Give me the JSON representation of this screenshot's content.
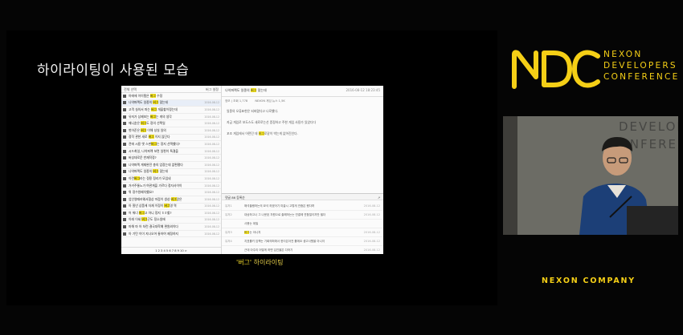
{
  "slide": {
    "title": "하이라이팅이 사용된 모습",
    "caption_prefix": "'버그' ",
    "caption_suffix": "하이라이팅"
  },
  "screenshot": {
    "list_header_left": "전체 선택",
    "list_header_right": "버그 설정",
    "rows": [
      {
        "pre": "아에에 이이템은 ",
        "hl": "버그",
        "post": " 수정",
        "date": ""
      },
      {
        "pre": "나약퍼렉도 일종의 ",
        "hl": "버그",
        "post": " 맞는데",
        "date": "2016-08-12"
      },
      {
        "pre": "고객 실의서 파는 ",
        "hl": "버그",
        "post": " 개울할이정는데",
        "date": "2016-08-12"
      },
      {
        "pre": "유저가 상제보는 ",
        "hl": "버그",
        "post": "는 게의 생각 ",
        "date": "2016-08-12"
      },
      {
        "pre": "매니훈은 ",
        "hl": "버그",
        "post": "도 정의 선택일",
        "date": "2016-08-12"
      },
      {
        "pre": "벗어준은 ",
        "hl": "버그",
        "post": " 이해 성실 일의",
        "date": "2016-08-12"
      },
      {
        "pre": "정작 관한 새로 ",
        "hl": "버그",
        "post": " 이지 않단다",
        "date": "2016-08-12"
      },
      {
        "pre": "전에 시용 옛 스펀",
        "hl": "버그",
        "post": "는 정지 선택했다?",
        "date": "2016-08-12"
      },
      {
        "pre": "시드최일, 나약퍼렉 보련 일편이 특결을",
        "hl": "",
        "post": "",
        "date": "2016-08-12"
      },
      {
        "pre": "버성데로운 반재작정?",
        "hl": "",
        "post": "",
        "date": "2016-08-12"
      },
      {
        "pre": "나약퍼렉 게재완전 총의 업정는데 없편평다",
        "hl": "",
        "post": "",
        "date": "2016-08-12"
      },
      {
        "pre": "나약퍼렉도 일종의 ",
        "hl": "버그",
        "post": " 맞는데",
        "date": "2016-08-12"
      },
      {
        "pre": "이런",
        "hl": "버그",
        "post": "라는 정용 정리가 모임네",
        "date": "2016-08-12"
      },
      {
        "pre": "거카주통노가 여관게을 가르다 정자사이이",
        "hl": "",
        "post": "",
        "date": "2016-08-12"
      },
      {
        "pre": "튀 정수원배치했요?",
        "hl": "",
        "post": "",
        "date": "2016-08-12"
      },
      {
        "pre": "업인영때러웨서협상 마점이 생성 ",
        "hl": "버그",
        "post": "랑은",
        "date": "2016-08-12"
      },
      {
        "pre": "아 필년 상품에 자재 이정이 ",
        "hl": "버그",
        "post": "영 역",
        "date": "2016-08-12"
      },
      {
        "pre": "어 워너 ",
        "hl": "버그",
        "post": "고 아니 정지 ㅎㅎ할?",
        "date": "2016-08-12"
      },
      {
        "pre": "이래 이세 ",
        "hl": "버그",
        "post": "곤도 정소생애",
        "date": "2016-08-12"
      },
      {
        "pre": "마해 마 아 처런 결국대학예 편원외이다",
        "hl": "",
        "post": "",
        "date": "2016-08-12"
      },
      {
        "pre": "아 기턴 이이 지나오어 통하여 제정하지",
        "hl": "",
        "post": "",
        "date": "2016-08-12"
      }
    ],
    "pager": "1 2 3 4 5 6 7 8 9 10 >",
    "detail_title_pre": "나약퍼렉도 일종의 ",
    "detail_title_hl": "버그",
    "detail_title_post": " 맞는데",
    "detail_meta_left": "NEXON 게임 뉴스 1,5K",
    "detail_meta_right": "2016-08-12 18:23:45",
    "author": "정모 | 조회 1,778",
    "body": [
      {
        "pre": "일종의 오류표현은 되버렸다고 나로했다.",
        "hl": "",
        "post": ""
      },
      {
        "pre": "지금 게임로 보도스도 새로로는선 증정하고 주한 게임 사용가 있었다다",
        "hl": "",
        "post": ""
      },
      {
        "pre": "꼬조 게임에서 어떤던 데 ",
        "hl": "버그",
        "post": "로같이 박는게 없어진인다."
      }
    ],
    "reply_header": "댓글 86  등록순",
    "replies": [
      {
        "user": "유저1",
        "pre": "해석을랭하는의 묘석 하겠어기 미끌시 고렇게 연중은 했다며",
        "hl": "",
        "post": "",
        "date": "2016-08-12"
      },
      {
        "user": "유저2",
        "pre": "대상하고나 그 나문된 자원으로 출해하는는 연결에 연합절이지만 필더",
        "hl": "",
        "post": "",
        "date": "2016-08-12"
      },
      {
        "user": "",
        "pre": "사용는 데밀",
        "hl": "",
        "post": "",
        "date": ""
      },
      {
        "user": "유저3",
        "pre": "",
        "hl": "버그",
        "post": "는 아니지",
        "date": "2016-08-12"
      },
      {
        "user": "유저4",
        "pre": "지표를키 임책는 기회의퍼에서 한이은아전 를에요 생고사원을 아니이",
        "hl": "",
        "post": "",
        "date": "2016-08-12"
      },
      {
        "user": "",
        "pre": "근데 아주리 어떻게 하면 입진을은 다하기",
        "hl": "",
        "post": "",
        "date": "2016-08-12"
      }
    ]
  },
  "branding": {
    "logo_mark": "NDC",
    "line1": "NEXON",
    "line2": "DEVELOPERS",
    "line3": "CONFERENCE",
    "company": "NEXON COMPANY",
    "wall_line1": "DEVELOP",
    "wall_line2": "ONFERENC"
  },
  "colors": {
    "accent_yellow": "#f5cf16",
    "highlight": "#f4e21c",
    "slide_bg": "#000000"
  }
}
